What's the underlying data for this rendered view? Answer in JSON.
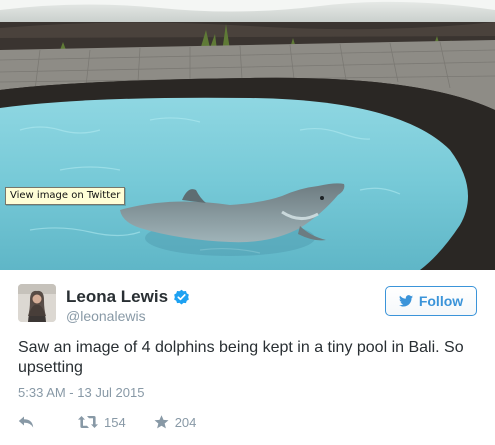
{
  "photo": {
    "tooltip": "View image on Twitter"
  },
  "author": {
    "name": "Leona Lewis",
    "handle": "@leonalewis",
    "verified": true
  },
  "follow_button": {
    "label": "Follow"
  },
  "tweet": {
    "text": "Saw an image of 4 dolphins being kept in a tiny pool in Bali. So upsetting",
    "timestamp": "5:33 AM - 13 Jul 2015"
  },
  "actions": {
    "retweet_count": "154",
    "favorite_count": "204"
  },
  "colors": {
    "accent": "#3b94d9",
    "text": "#292f33",
    "muted": "#8899a6",
    "pool_water": "#7ecfdc"
  },
  "icons": [
    "verified-badge-icon",
    "twitter-bird-icon",
    "reply-icon",
    "retweet-icon",
    "favorite-star-icon"
  ]
}
